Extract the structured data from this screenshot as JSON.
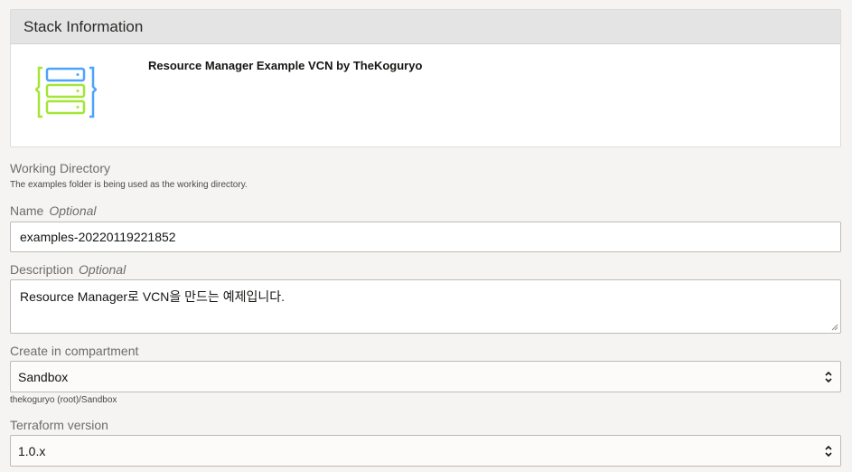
{
  "stack_info": {
    "header": "Stack Information",
    "stack_name": "Resource Manager Example VCN by TheKoguryo",
    "icon": "server-stack-icon"
  },
  "working_directory": {
    "label": "Working Directory",
    "hint": "The examples folder is being used as the working directory."
  },
  "name": {
    "label": "Name",
    "optional": "Optional",
    "value": "examples-20220119221852"
  },
  "description": {
    "label": "Description",
    "optional": "Optional",
    "value": "Resource Manager로 VCN을 만드는 예제입니다."
  },
  "compartment": {
    "label": "Create in compartment",
    "value": "Sandbox",
    "path": "thekoguryo (root)/Sandbox"
  },
  "terraform": {
    "label": "Terraform version",
    "value": "1.0.x"
  }
}
